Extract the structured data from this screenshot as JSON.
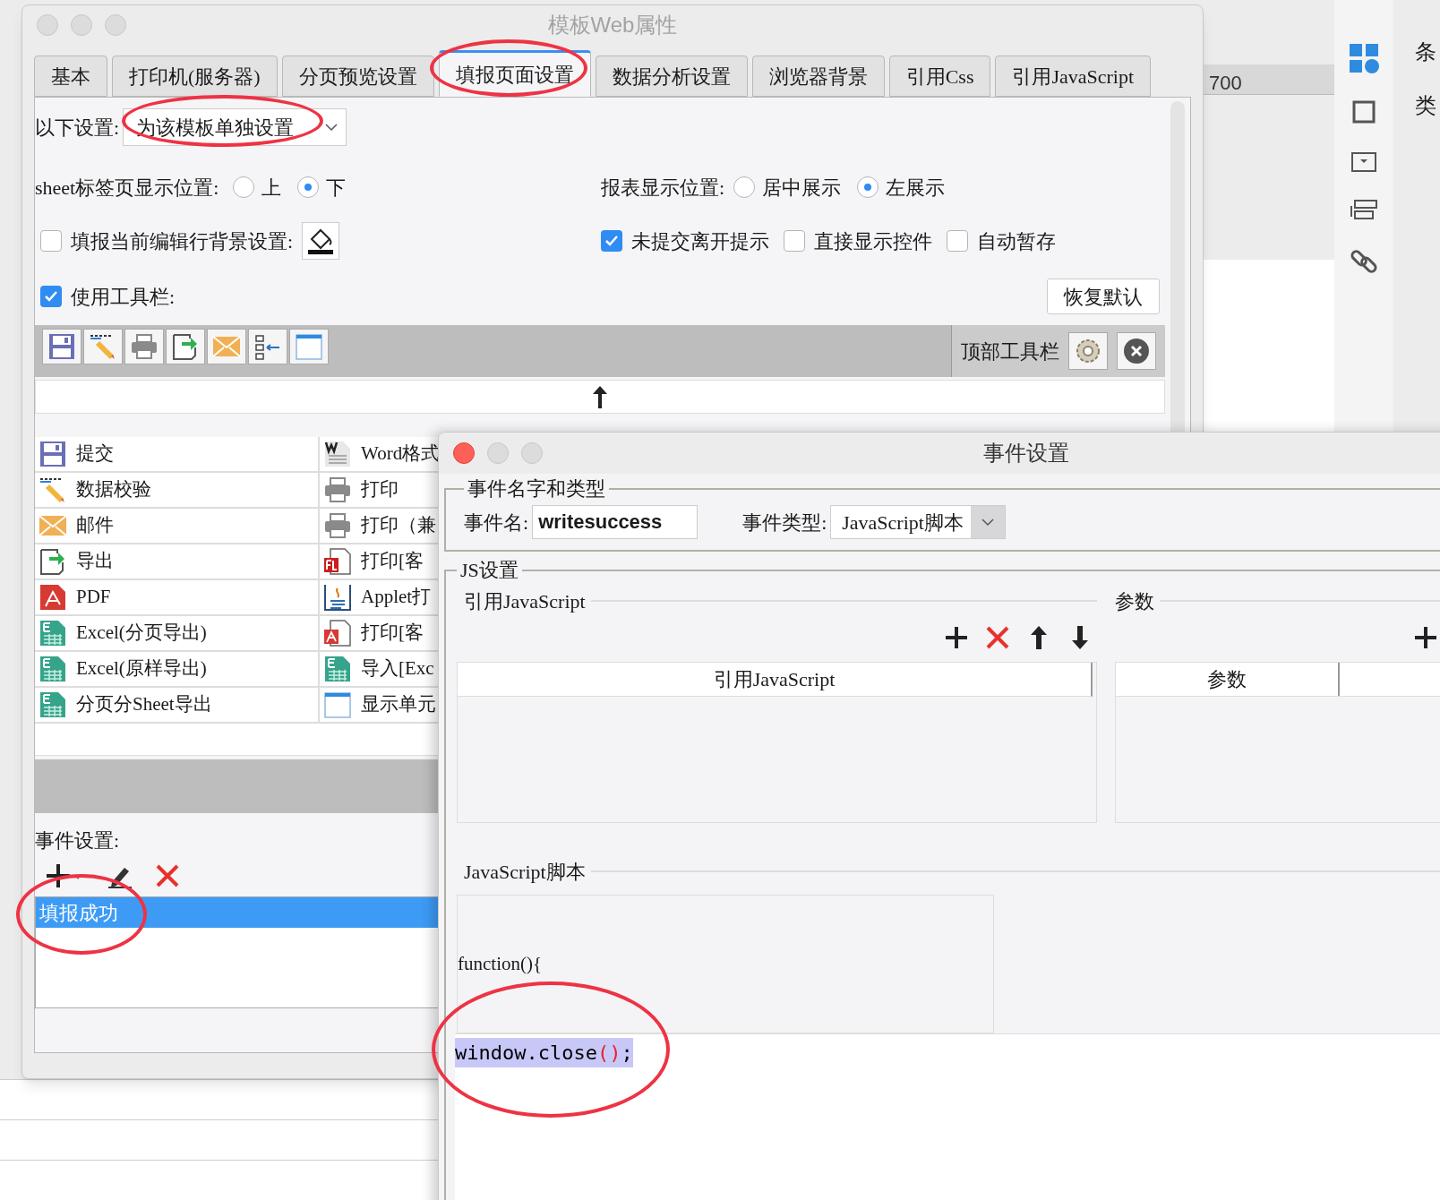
{
  "background": {
    "ruler_label": "700",
    "side_labels": [
      "条",
      "类"
    ]
  },
  "main_window": {
    "title": "模板Web属性",
    "tabs": [
      {
        "label": "基本",
        "selected": false
      },
      {
        "label": "打印机(服务器)",
        "selected": false
      },
      {
        "label": "分页预览设置",
        "selected": false
      },
      {
        "label": "填报页面设置",
        "selected": true
      },
      {
        "label": "数据分析设置",
        "selected": false
      },
      {
        "label": "浏览器背景",
        "selected": false
      },
      {
        "label": "引用Css",
        "selected": false
      },
      {
        "label": "引用JavaScript",
        "selected": false
      }
    ],
    "scope": {
      "label": "以下设置:",
      "value": "为该模板单独设置"
    },
    "sheet_position": {
      "label": "sheet标签页显示位置:",
      "options": [
        {
          "label": "上",
          "selected": false
        },
        {
          "label": "下",
          "selected": true
        }
      ]
    },
    "report_position": {
      "label": "报表显示位置:",
      "options": [
        {
          "label": "居中展示",
          "selected": false
        },
        {
          "label": "左展示",
          "selected": true
        }
      ]
    },
    "row_background": {
      "label": "填报当前编辑行背景设置:",
      "checked": false
    },
    "options": [
      {
        "label": "未提交离开提示",
        "checked": true
      },
      {
        "label": "直接显示控件",
        "checked": false
      },
      {
        "label": "自动暂存",
        "checked": false
      }
    ],
    "use_toolbar": {
      "label": "使用工具栏:",
      "checked": true
    },
    "restore_button": "恢复默认",
    "top_toolbar_label": "顶部工具栏",
    "button_list": [
      {
        "label": "提交",
        "kind": "save"
      },
      {
        "label": "Word格式",
        "kind": "word"
      },
      {
        "label": "数据校验",
        "kind": "pencil"
      },
      {
        "label": "打印",
        "kind": "print"
      },
      {
        "label": "邮件",
        "kind": "mail"
      },
      {
        "label": "打印（兼",
        "kind": "print"
      },
      {
        "label": "导出",
        "kind": "export"
      },
      {
        "label": "打印[客",
        "kind": "flash"
      },
      {
        "label": "PDF",
        "kind": "pdf"
      },
      {
        "label": "Applet打",
        "kind": "applet"
      },
      {
        "label": "Excel(分页导出)",
        "kind": "excel"
      },
      {
        "label": "打印[客",
        "kind": "pdfdoc"
      },
      {
        "label": "Excel(原样导出)",
        "kind": "excel"
      },
      {
        "label": "导入[Exc",
        "kind": "excel"
      },
      {
        "label": "分页分Sheet导出",
        "kind": "excel"
      },
      {
        "label": "显示单元",
        "kind": "frame"
      }
    ],
    "events_label": "事件设置:",
    "events": [
      {
        "label": "填报成功",
        "selected": true
      }
    ]
  },
  "event_dialog": {
    "title": "事件设置",
    "name_group": "事件名字和类型",
    "name_label": "事件名:",
    "name_value": "writesuccess",
    "type_label": "事件类型:",
    "type_value": "JavaScript脚本",
    "js_group": "JS设置",
    "ref_section": "引用JavaScript",
    "params_section": "参数",
    "ref_column": "引用JavaScript",
    "params_column": "参数",
    "script_section": "JavaScript脚本",
    "script_header": "function(){",
    "code_lines": [
      {
        "selected": true,
        "tokens": [
          {
            "text": "window.close",
            "kind": "plain"
          },
          {
            "text": "()",
            "kind": "paren"
          },
          {
            "text": ";",
            "kind": "plain"
          }
        ]
      }
    ]
  }
}
